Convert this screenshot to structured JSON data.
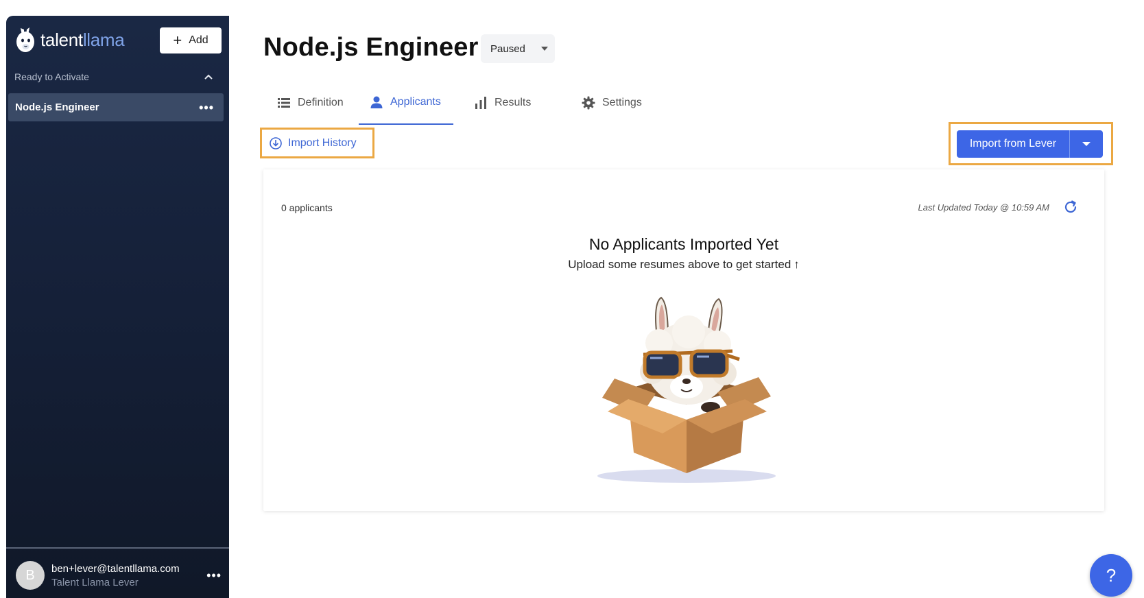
{
  "brand": {
    "name_prefix": "talent",
    "name_accent": "llama"
  },
  "sidebar": {
    "add_label": "Add",
    "section_label": "Ready to Activate",
    "items": [
      {
        "label": "Node.js Engineer"
      }
    ],
    "user": {
      "initial": "B",
      "email": "ben+lever@talentllama.com",
      "org": "Talent Llama Lever"
    }
  },
  "header": {
    "title": "Node.js Engineer",
    "status": "Paused"
  },
  "tabs": [
    {
      "label": "Definition",
      "icon": "list-icon"
    },
    {
      "label": "Applicants",
      "icon": "person-icon",
      "active": true
    },
    {
      "label": "Results",
      "icon": "bar-chart-icon"
    },
    {
      "label": "Settings",
      "icon": "gear-icon"
    }
  ],
  "actions": {
    "import_history": "Import History",
    "import_lever": "Import from Lever"
  },
  "card": {
    "count": "0 applicants",
    "updated": "Last Updated Today @ 10:59 AM",
    "empty_title": "No Applicants Imported Yet",
    "empty_sub": "Upload some resumes above to get started",
    "empty_arrow": "↑"
  },
  "help": "?",
  "colors": {
    "accent": "#3d66e6",
    "highlight": "#eba843",
    "sidebar": "#152038"
  }
}
